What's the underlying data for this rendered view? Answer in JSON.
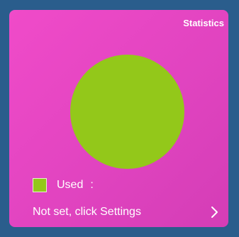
{
  "widget": {
    "title": "Statistics",
    "legend": {
      "label": "Used",
      "separator": ":",
      "color": "#93c81a"
    },
    "footer": {
      "link_text": "Not set, click Settings",
      "icon": "chevron-right-icon"
    }
  },
  "chart_data": {
    "type": "pie",
    "series": [
      {
        "name": "Used",
        "values": [
          1
        ]
      }
    ],
    "colors": [
      "#93c81a"
    ]
  },
  "colors": {
    "page_background": "#2a5d8c",
    "card_background": "#e144c0",
    "text": "#ffffff"
  }
}
